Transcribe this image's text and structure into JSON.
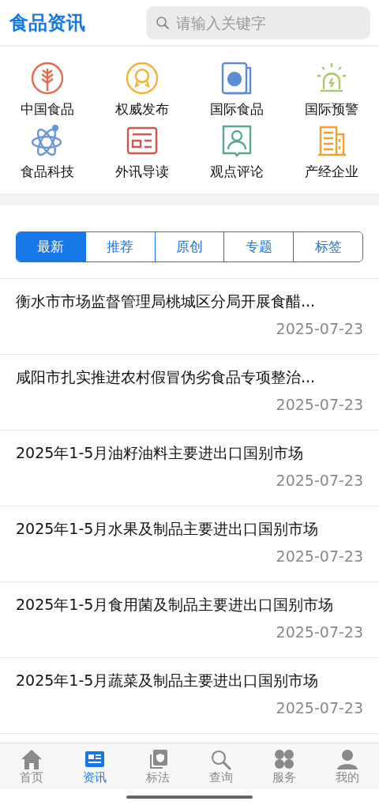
{
  "header": {
    "title": "食品资讯",
    "search": {
      "placeholder": "请输入关键字"
    }
  },
  "categories": [
    {
      "label": "中国食品",
      "kind": "wheat",
      "color": "#e8684a"
    },
    {
      "label": "权威发布",
      "kind": "medal",
      "color": "#f2b233"
    },
    {
      "label": "国际食品",
      "kind": "globe",
      "color": "#5b8dd6"
    },
    {
      "label": "国际预警",
      "kind": "alarm",
      "color": "#a9c96b"
    },
    {
      "label": "食品科技",
      "kind": "atom",
      "color": "#6a95dd"
    },
    {
      "label": "外讯导读",
      "kind": "news",
      "color": "#d9534f"
    },
    {
      "label": "观点评论",
      "kind": "person",
      "color": "#5aa88a"
    },
    {
      "label": "产经企业",
      "kind": "building",
      "color": "#f0a030"
    }
  ],
  "tabs": [
    {
      "label": "最新",
      "selected": true
    },
    {
      "label": "推荐",
      "selected": false
    },
    {
      "label": "原创",
      "selected": false
    },
    {
      "label": "专题",
      "selected": false
    },
    {
      "label": "标签",
      "selected": false
    }
  ],
  "articles": [
    {
      "title": "衡水市市场监督管理局桃城区分局开展食醋...",
      "date": "2025-07-23"
    },
    {
      "title": "咸阳市扎实推进农村假冒伪劣食品专项整治...",
      "date": "2025-07-23"
    },
    {
      "title": "2025年1-5月油籽油料主要进出口国别市场",
      "date": "2025-07-23"
    },
    {
      "title": "2025年1-5月水果及制品主要进出口国别市场",
      "date": "2025-07-23"
    },
    {
      "title": "2025年1-5月食用菌及制品主要进出口国别市场",
      "date": "2025-07-23"
    },
    {
      "title": "2025年1-5月蔬菜及制品主要进出口国别市场",
      "date": "2025-07-23"
    }
  ],
  "nav": [
    {
      "label": "首页",
      "kind": "home",
      "selected": false
    },
    {
      "label": "资讯",
      "kind": "news",
      "selected": true
    },
    {
      "label": "标法",
      "kind": "shield",
      "selected": false
    },
    {
      "label": "查询",
      "kind": "search",
      "selected": false
    },
    {
      "label": "服务",
      "kind": "grid",
      "selected": false
    },
    {
      "label": "我的",
      "kind": "user",
      "selected": false
    }
  ]
}
